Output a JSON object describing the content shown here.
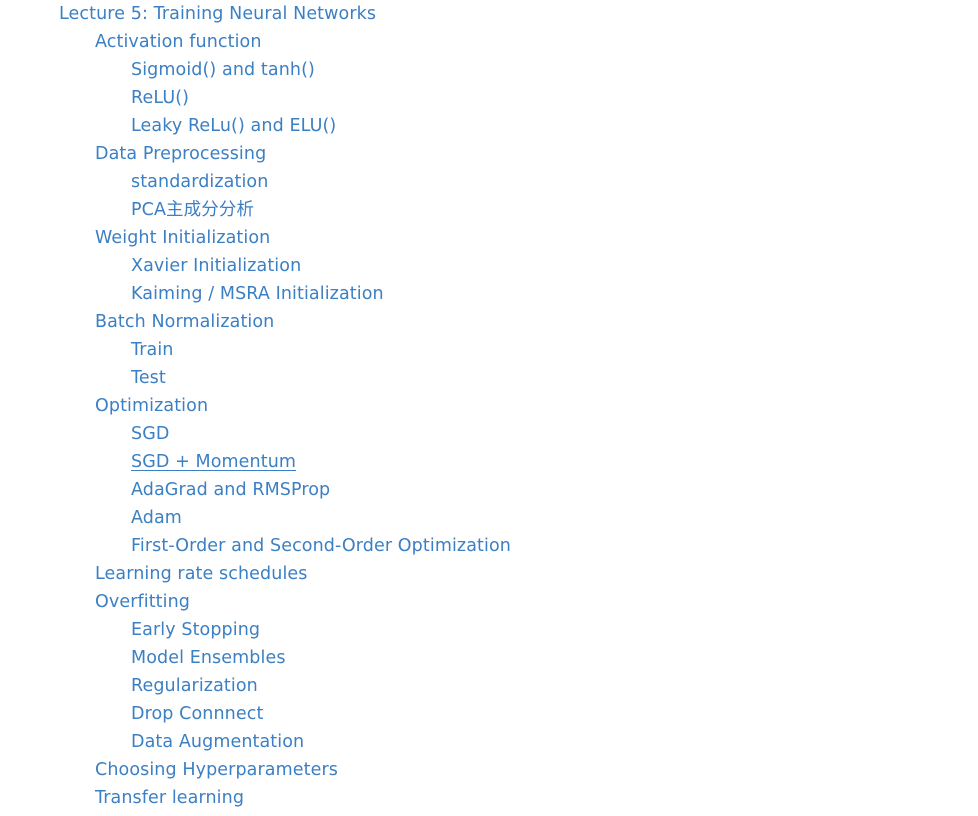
{
  "toc": {
    "active_color": "#3b7fc4",
    "items": [
      {
        "label": "Lecture 5: Training Neural Networks",
        "level": 0
      },
      {
        "label": "Activation function",
        "level": 1
      },
      {
        "label": "Sigmoid() and tanh()",
        "level": 2
      },
      {
        "label": "ReLU()",
        "level": 2
      },
      {
        "label": "Leaky ReLu() and ELU()",
        "level": 2
      },
      {
        "label": "Data Preprocessing",
        "level": 1
      },
      {
        "label": "standardization",
        "level": 2
      },
      {
        "label": "PCA主成分分析",
        "level": 2
      },
      {
        "label": "Weight Initialization",
        "level": 1
      },
      {
        "label": "Xavier Initialization",
        "level": 2
      },
      {
        "label": "Kaiming / MSRA Initialization",
        "level": 2
      },
      {
        "label": "Batch Normalization",
        "level": 1
      },
      {
        "label": "Train",
        "level": 2
      },
      {
        "label": "Test",
        "level": 2
      },
      {
        "label": "Optimization",
        "level": 1
      },
      {
        "label": "SGD",
        "level": 2
      },
      {
        "label": "SGD + Momentum",
        "level": 2,
        "active": true
      },
      {
        "label": "AdaGrad and RMSProp",
        "level": 2
      },
      {
        "label": "Adam",
        "level": 2
      },
      {
        "label": "First-Order and Second-Order Optimization",
        "level": 2
      },
      {
        "label": "Learning rate schedules",
        "level": 1
      },
      {
        "label": "Overfitting",
        "level": 1
      },
      {
        "label": "Early Stopping",
        "level": 2
      },
      {
        "label": "Model Ensembles",
        "level": 2
      },
      {
        "label": "Regularization",
        "level": 2
      },
      {
        "label": "Drop Connnect",
        "level": 2
      },
      {
        "label": "Data Augmentation",
        "level": 2
      },
      {
        "label": "Choosing Hyperparameters",
        "level": 1
      },
      {
        "label": "Transfer learning",
        "level": 1
      }
    ]
  }
}
